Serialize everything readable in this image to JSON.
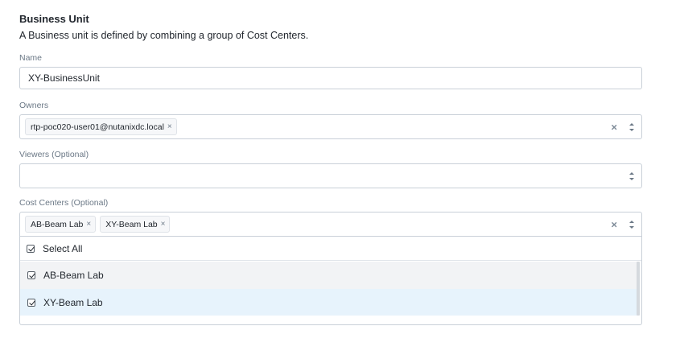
{
  "section": {
    "title": "Business Unit",
    "description": "A Business unit is defined by combining a group of Cost Centers."
  },
  "name_field": {
    "label": "Name",
    "value": "XY-BusinessUnit"
  },
  "owners_field": {
    "label": "Owners",
    "chips": [
      "rtp-poc020-user01@nutanixdc.local"
    ],
    "clear_glyph": "×",
    "chip_remove_glyph": "×"
  },
  "viewers_field": {
    "label": "Viewers (Optional)"
  },
  "cost_centers_field": {
    "label": "Cost Centers (Optional)",
    "chips": [
      "AB-Beam Lab",
      "XY-Beam Lab"
    ],
    "dropdown": {
      "select_all_label": "Select All",
      "select_all_checked": true,
      "options": [
        {
          "label": "AB-Beam Lab",
          "checked": true,
          "state": "hover"
        },
        {
          "label": "XY-Beam Lab",
          "checked": true,
          "state": "focused"
        }
      ]
    }
  },
  "icons": [
    "clear-icon",
    "caret-updown-icon",
    "checkbox-checked-icon",
    "chip-remove-icon"
  ],
  "colors": {
    "border": "#c9d0d8",
    "label": "#6b7886",
    "hover_row": "#f2f3f5",
    "focused_row": "#e7f3fc"
  }
}
